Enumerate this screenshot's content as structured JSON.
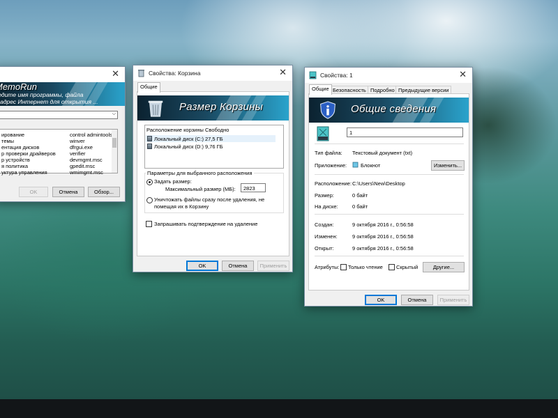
{
  "memorun": {
    "banner_title": "MemoRun",
    "banner_line1": "ведите имя программы, файла",
    "banner_line2": "и адрес Интернет для открытия ...",
    "list_left": [
      "ирование",
      "темы",
      "ентация дисков",
      "р проверки драйверов",
      "р устройств",
      "я политика",
      "уктура управления"
    ],
    "list_right": [
      "control admintools",
      "winver",
      "dfrgui.exe",
      "verifier",
      "devmgmt.msc",
      "gpedit.msc",
      "wmimgmt.msc"
    ],
    "ok": "OK",
    "cancel": "Отмена",
    "browse": "Обзор..."
  },
  "recycle": {
    "title": "Свойства: Корзина",
    "tab_general": "Общие",
    "banner": "Размер Корзины",
    "col_location": "Расположение корзины",
    "col_free": "Свободно",
    "drives": [
      {
        "name": "Локальный диск (C:)",
        "free": "27,5 ГБ"
      },
      {
        "name": "Локальный диск (D:)",
        "free": "9,76 ГБ"
      }
    ],
    "params_label": "Параметры для выбранного расположения",
    "custom_size": "Задать размер:",
    "max_size_label": "Максимальный размер (МБ):",
    "max_size_value": "2823",
    "delete_line1": "Уничтожать файлы сразу после удаления, не",
    "delete_line2": "помещая их в Корзину",
    "confirm_delete": "Запрашивать подтверждение на удаление",
    "ok": "OK",
    "cancel": "Отмена",
    "apply": "Применить"
  },
  "props": {
    "title": "Свойства: 1",
    "tabs": [
      "Общие",
      "Безопасность",
      "Подробно",
      "Предыдущие версии"
    ],
    "banner": "Общие сведения",
    "file_name": "1",
    "file_type_label": "Тип файла:",
    "file_type_value": "Текстовый документ (txt)",
    "app_label": "Приложение:",
    "app_value": "Блокнот",
    "change_btn": "Изменить...",
    "location_label": "Расположение:",
    "location_value": "C:\\Users\\New\\Desktop",
    "size_label": "Размер:",
    "size_value": "0 байт",
    "disk_label": "На диске:",
    "disk_value": "0 байт",
    "created_label": "Создан:",
    "created_value": "9 октября 2016 г., 0:56:58",
    "modified_label": "Изменен:",
    "modified_value": "9 октября 2016 г., 0:56:58",
    "opened_label": "Открыт:",
    "opened_value": "9 октября 2016 г., 0:56:58",
    "attributes_label": "Атрибуты:",
    "readonly": "Только чтение",
    "hidden": "Скрытый",
    "other_btn": "Другие...",
    "ok": "OK",
    "cancel": "Отмена",
    "apply": "Применить"
  },
  "colors": {
    "accent": "#0078d7",
    "banner_dark": "#0b2230",
    "banner_light": "#2aa3cc"
  }
}
